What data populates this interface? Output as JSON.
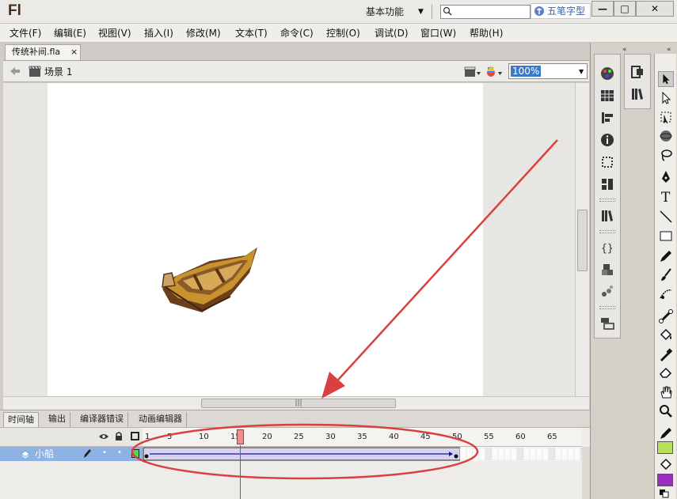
{
  "app": {
    "logo": "Fl",
    "workspace": "基本功能",
    "watermark": "五笔字型"
  },
  "window_buttons": {
    "minimize": "—",
    "maximize": "□",
    "close": "✕"
  },
  "menu": [
    "文件(F)",
    "编辑(E)",
    "视图(V)",
    "插入(I)",
    "修改(M)",
    "文本(T)",
    "命令(C)",
    "控制(O)",
    "调试(D)",
    "窗口(W)",
    "帮助(H)"
  ],
  "document": {
    "tab_name": "传统补间.fla",
    "close": "×",
    "scene": "场景 1",
    "zoom": "100%"
  },
  "panel_tabs": [
    "时间轴",
    "输出",
    "编译器错误",
    "动画编辑器"
  ],
  "timeline": {
    "layer_name": "小船",
    "frame_ticks": [
      "1",
      "5",
      "10",
      "15",
      "20",
      "25",
      "30",
      "35",
      "40",
      "45",
      "50",
      "55",
      "60",
      "65"
    ],
    "current_frame": 16,
    "tween_start": 1,
    "tween_end": 50
  },
  "colors": {
    "stroke": "#b6e05a",
    "fill": "#9b2fc4",
    "annotation": "#d94040",
    "layer_highlight": "#8db3e5"
  }
}
